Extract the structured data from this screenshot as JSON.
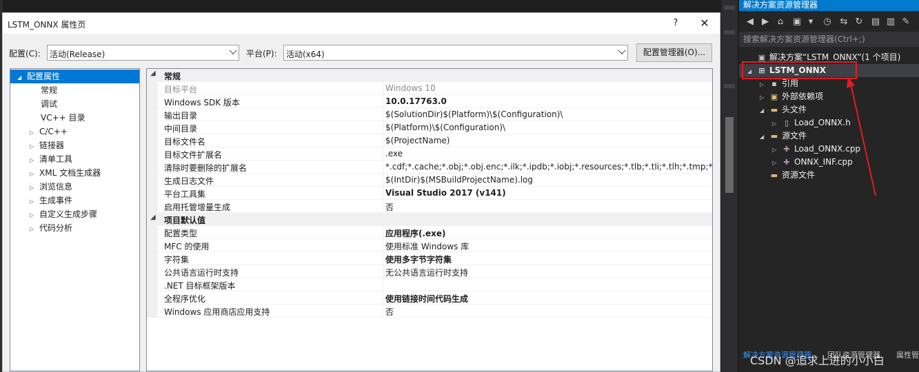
{
  "dialog": {
    "title": "LSTM_ONNX 属性页",
    "help": "?",
    "close": "✕",
    "config_label": "配置(C):",
    "config_value": "活动(Release)",
    "platform_label": "平台(P):",
    "platform_value": "活动(x64)",
    "config_manager_btn": "配置管理器(O)..."
  },
  "tree": [
    {
      "label": "配置属性",
      "expander": "◢",
      "selected": true
    },
    {
      "label": "常规"
    },
    {
      "label": "调试"
    },
    {
      "label": "VC++ 目录"
    },
    {
      "label": "C/C++",
      "expander": "▷"
    },
    {
      "label": "链接器",
      "expander": "▷"
    },
    {
      "label": "清单工具",
      "expander": "▷"
    },
    {
      "label": "XML 文档生成器",
      "expander": "▷"
    },
    {
      "label": "浏览信息",
      "expander": "▷"
    },
    {
      "label": "生成事件",
      "expander": "▷"
    },
    {
      "label": "自定义生成步骤",
      "expander": "▷"
    },
    {
      "label": "代码分析",
      "expander": "▷"
    }
  ],
  "grid": {
    "groups": [
      {
        "title": "常规",
        "rows": [
          {
            "name": "目标平台",
            "value": "Windows 10",
            "muted": true
          },
          {
            "name": "Windows SDK 版本",
            "value": "10.0.17763.0",
            "bold": true
          },
          {
            "name": "输出目录",
            "value": "$(SolutionDir)$(Platform)\\$(Configuration)\\"
          },
          {
            "name": "中间目录",
            "value": "$(Platform)\\$(Configuration)\\"
          },
          {
            "name": "目标文件名",
            "value": "$(ProjectName)"
          },
          {
            "name": "目标文件扩展名",
            "value": ".exe"
          },
          {
            "name": "清除时要删除的扩展名",
            "value": "*.cdf;*.cache;*.obj;*.obj.enc;*.ilk;*.ipdb;*.iobj;*.resources;*.tlb;*.tli;*.tlh;*.tmp;*.rsp;*.pgc"
          },
          {
            "name": "生成日志文件",
            "value": "$(IntDir)$(MSBuildProjectName).log"
          },
          {
            "name": "平台工具集",
            "value": "Visual Studio 2017 (v141)",
            "bold": true
          },
          {
            "name": "启用托管增量生成",
            "value": "否"
          }
        ]
      },
      {
        "title": "项目默认值",
        "rows": [
          {
            "name": "配置类型",
            "value": "应用程序(.exe)",
            "bold": true
          },
          {
            "name": "MFC 的使用",
            "value": "使用标准 Windows 库"
          },
          {
            "name": "字符集",
            "value": "使用多字节字符集",
            "bold": true
          },
          {
            "name": "公共语言运行时支持",
            "value": "无公共语言运行时支持"
          },
          {
            "name": ".NET 目标框架版本",
            "value": ""
          },
          {
            "name": "全程序优化",
            "value": "使用链接时间代码生成",
            "bold": true
          },
          {
            "name": "Windows 应用商店应用支持",
            "value": "否"
          }
        ]
      }
    ]
  },
  "solution_explorer": {
    "title": "解决方案资源管理器",
    "search_placeholder": "搜索解决方案资源管理器(Ctrl+;)",
    "items": [
      {
        "label": "解决方案“LSTM_ONNX”(1 个项目)",
        "level": 0,
        "expander": "",
        "icon": "solution-icon"
      },
      {
        "label": "LSTM_ONNX",
        "level": 0,
        "expander": "◢",
        "icon": "project-icon",
        "bold": true
      },
      {
        "label": "引用",
        "level": 1,
        "expander": "▷",
        "icon": "references-icon"
      },
      {
        "label": "外部依赖项",
        "level": 1,
        "expander": "▷",
        "icon": "external-deps-icon"
      },
      {
        "label": "头文件",
        "level": 1,
        "expander": "◢",
        "icon": "folder-icon"
      },
      {
        "label": "Load_ONNX.h",
        "level": 2,
        "expander": "▷",
        "icon": "header-file-icon"
      },
      {
        "label": "源文件",
        "level": 1,
        "expander": "◢",
        "icon": "folder-icon"
      },
      {
        "label": "Load_ONNX.cpp",
        "level": 2,
        "expander": "▷",
        "icon": "cpp-file-icon"
      },
      {
        "label": "ONNX_INF.cpp",
        "level": 2,
        "expander": "▷",
        "icon": "cpp-file-icon"
      },
      {
        "label": "资源文件",
        "level": 1,
        "expander": "",
        "icon": "folder-icon"
      }
    ],
    "bottom_tabs": [
      "解决方案资源管理器",
      "团队资源管理器",
      "属性管理器"
    ]
  },
  "watermark": "CSDN @追求上进的小小白",
  "colors": {
    "accent": "#0078d7",
    "vs_blue": "#007acc",
    "highlight": "#e51c23"
  }
}
